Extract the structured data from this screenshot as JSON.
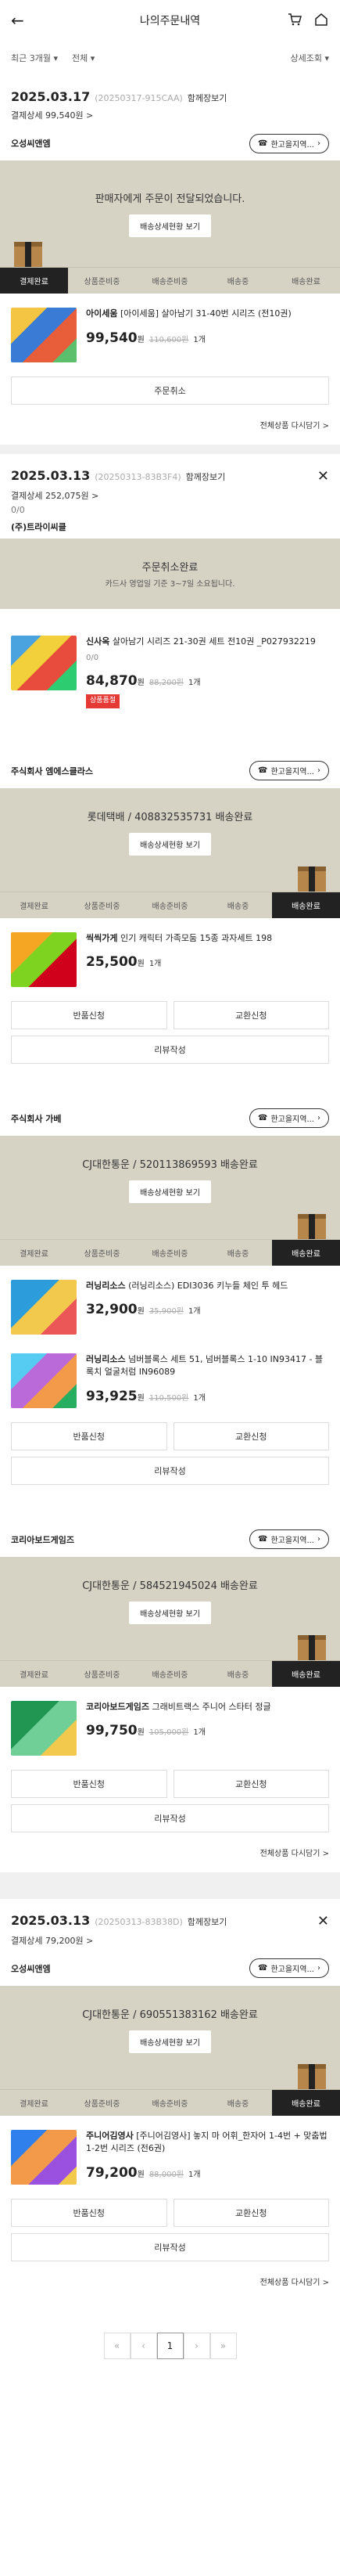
{
  "header": {
    "title": "나의주문내역"
  },
  "filters": {
    "period": "최근 3개월",
    "type": "전체",
    "detail": "상세조회"
  },
  "common": {
    "shipping_detail": "배송상세현황 보기",
    "parcel_btn": "한고을지역...",
    "cancel": "주문취소",
    "return": "반품신청",
    "exchange": "교환신청",
    "review": "리뷰작성",
    "reorder": "전체상품 다시담기",
    "won": "원",
    "arrow": ">"
  },
  "steps": [
    "결제완료",
    "상품준비중",
    "배송준비중",
    "배송중",
    "배송완료"
  ],
  "orders": [
    {
      "date": "2025.03.17",
      "no": "(20250317-915CAA)",
      "together": "함께장보기",
      "pay": "결제상세 99,540원",
      "sellers": [
        {
          "name": "오성씨앤엠",
          "status": "판매자에게 주문이 전달되었습니다.",
          "items": [
            {
              "brand": "아이세움",
              "title": "[아이세움] 살아남기 31-40번 시리즈 (전10권)",
              "price": "99,540",
              "orig": "110,600원",
              "qty": "1개"
            }
          ]
        }
      ]
    },
    {
      "date": "2025.03.13",
      "no": "(20250313-83B3F4)",
      "together": "함께장보기",
      "pay": "결제상세 252,075원",
      "pay2": "0/0",
      "sellers": [
        {
          "name": "(주)트라이씨클",
          "status": "주문취소완료",
          "status_sub": "카드사 영업일 기준 3~7일 소요됩니다.",
          "items": [
            {
              "brand": "신사옥",
              "title": "살아남기 시리즈 21-30권 세트 전10권 _P027932219",
              "price": "84,870",
              "orig": "88,200원",
              "qty": "1개",
              "extra": "0/0",
              "tag": "상품품절"
            }
          ]
        },
        {
          "name": "주식회사 엠에스클라스",
          "status": "롯데택배 / 408832535731 배송완료",
          "items": [
            {
              "brand": "씩씩가게",
              "title": "인기 캐릭터 가족모둠 15종 과자세트 198",
              "price": "25,500",
              "orig": "",
              "qty": "1개"
            }
          ]
        },
        {
          "name": "주식회사 가베",
          "status": "CJ대한통운 / 520113869593 배송완료",
          "items": [
            {
              "brand": "러닝리소스",
              "title": "(러닝리소스) EDI3036 키누들 체인 투 헤드",
              "price": "32,900",
              "orig": "35,900원",
              "qty": "1개"
            },
            {
              "brand": "러닝리소스",
              "title": "넘버블록스 세트 51, 넘버블록스 1-10 IN93417 - 블록치 얼굴처럼 IN96089",
              "price": "93,925",
              "orig": "110,500원",
              "qty": "1개"
            }
          ]
        },
        {
          "name": "코리아보드게임즈",
          "status": "CJ대한통운 / 584521945024 배송완료",
          "items": [
            {
              "brand": "코리아보드게임즈",
              "title": "그래비트랙스 주니어 스타터 정글",
              "price": "99,750",
              "orig": "105,000원",
              "qty": "1개"
            }
          ]
        }
      ]
    },
    {
      "date": "2025.03.13",
      "no": "(20250313-83B38D)",
      "together": "함께장보기",
      "pay": "결제상세 79,200원",
      "sellers": [
        {
          "name": "오성씨앤엠",
          "status": "CJ대한통운 / 690551383162 배송완료",
          "items": [
            {
              "brand": "주니어김영사",
              "title": "[주니어김영사] 놓지 마 어휘_한자어 1-4번 + 맞춤법 1-2번 시리즈 (전6권)",
              "price": "79,200",
              "orig": "88,000원",
              "qty": "1개"
            }
          ]
        }
      ]
    }
  ],
  "pager": {
    "prev": "«",
    "prev1": "‹",
    "current": "1",
    "next1": "›",
    "next": "»"
  }
}
